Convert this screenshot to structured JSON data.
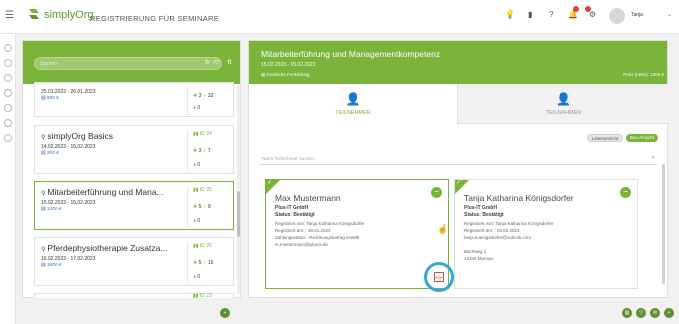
{
  "app": {
    "logo_brand": "simplyOrg",
    "title": "REGISTRIERUNG FÜR SEMINARE",
    "user_name": "Tanja"
  },
  "search": {
    "placeholder": "Suchen"
  },
  "seminars": [
    {
      "title": "",
      "dates": "25.01.2023 - 26.01.2023",
      "price": "600 €",
      "id": "",
      "stat_a": "3",
      "stat_b": "32",
      "zero": "0"
    },
    {
      "title": "simplyOrg Basics",
      "dates": "14.02.2023 - 15.02.2023",
      "price": "200 €",
      "id": "ID 24",
      "stat_a": "3",
      "stat_b": "7",
      "zero": "0"
    },
    {
      "title": "Mitarbeiterführung und Mana...",
      "dates": "15.02.2023 - 15.02.2023",
      "price": "1200 €",
      "id": "ID 25",
      "stat_a": "5",
      "stat_b": "9",
      "zero": "0"
    },
    {
      "title": "Pferdephysiotherapie Zusatza...",
      "dates": "16.02.2023 - 17.02.2023",
      "price": "1600 €",
      "id": "ID 26",
      "stat_a": "5",
      "stat_b": "15",
      "zero": "0"
    },
    {
      "title": "",
      "dates": "",
      "price": "",
      "id": "ID 23",
      "stat_a": "",
      "stat_b": "",
      "zero": ""
    }
  ],
  "detail": {
    "title": "Mitarbeiterführung und Managementkompetenz",
    "dates": "15.02.2023 - 15.02.2023",
    "category": "Fachliche Fortbildung",
    "price": "Preis (netto): 1200 €",
    "tab_participants": "TEILNEHMER",
    "tab_participants_2": "TEILNAHMEN",
    "view_list": "Listenansicht",
    "view_box": "Box-Ansicht",
    "participant_search_placeholder": "Nach Teilnehmer suchen"
  },
  "participants": [
    {
      "name": "Max Mustermann",
      "company": "Plus-IT GmbH",
      "status": "Status: Bestätigt",
      "lines": [
        "Registriert von: Tanja Katharina Königsdorfer",
        "Registriert am: : 30.01.2023",
        "Zahlungsstatus : Rechnungsbetrag erstellt",
        "m.mustermann@plus-it.de"
      ],
      "pdf_label": "PDF"
    },
    {
      "name": "Tanja Katharina Königsdorfer",
      "company": "Plus-IT GmbH",
      "status": "Status: Bestätigt",
      "lines": [
        "Registriert von: Tanja Katharina Königsdorfer",
        "Registriert am: : 03.02.2023",
        "tanja.koenigsdorfer@outlook.com",
        "",
        "Bachweg 1",
        "12345 Murnau"
      ]
    }
  ],
  "colors": {
    "accent": "#7ab43a",
    "highlight_ring": "#33a8d8"
  }
}
